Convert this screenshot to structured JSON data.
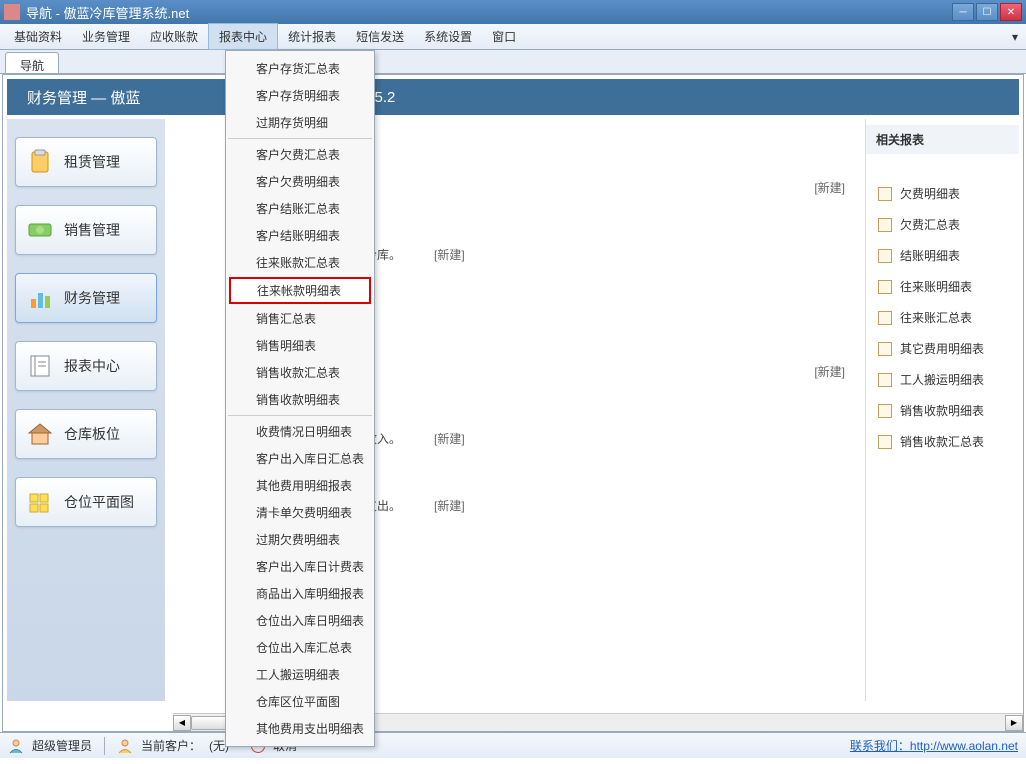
{
  "window": {
    "title": "导航 - 傲蓝冷库管理系统.net"
  },
  "menubar": {
    "items": [
      "基础资料",
      "业务管理",
      "应收账款",
      "报表中心",
      "统计报表",
      "短信发送",
      "系统设置",
      "窗口"
    ]
  },
  "tabstrip": {
    "tabs": [
      "导航"
    ]
  },
  "banner": {
    "text_left": "财务管理  ―  傲蓝",
    "text_right": "v5.2"
  },
  "sidebar": {
    "items": [
      {
        "label": "租赁管理"
      },
      {
        "label": "销售管理"
      },
      {
        "label": "财务管理"
      },
      {
        "label": "报表中心"
      },
      {
        "label": "仓库板位"
      },
      {
        "label": "仓位平面图"
      }
    ]
  },
  "main_items": [
    {
      "text": "",
      "new": "[新建]"
    },
    {
      "text": "冷库。",
      "new": "[新建]"
    },
    {
      "text": "",
      "new": "[新建]"
    },
    {
      "text": "收入。",
      "new": "[新建]"
    },
    {
      "text": "支出。",
      "new": "[新建]"
    }
  ],
  "right_panel": {
    "title": "相关报表",
    "items": [
      "欠费明细表",
      "欠费汇总表",
      "结账明细表",
      "往来账明细表",
      "往来账汇总表",
      "其它费用明细表",
      "工人搬运明细表",
      "销售收款明细表",
      "销售收款汇总表"
    ]
  },
  "dropdown": {
    "groups": [
      [
        "客户存货汇总表",
        "客户存货明细表",
        "过期存货明细"
      ],
      [
        "客户欠费汇总表",
        "客户欠费明细表",
        "客户结账汇总表",
        "客户结账明细表",
        "往来账款汇总表",
        "往来帐款明细表",
        "销售汇总表",
        "销售明细表",
        "销售收款汇总表",
        "销售收款明细表"
      ],
      [
        "收费情况日明细表",
        "客户出入库日汇总表",
        "其他费用明细报表",
        "清卡单欠费明细表",
        "过期欠费明细表",
        "客户出入库日计费表",
        "商品出入库明细报表",
        "仓位出入库日明细表",
        "仓位出入库汇总表",
        "工人搬运明细表",
        "仓库区位平面图",
        "其他费用支出明细表"
      ]
    ],
    "highlighted": "往来帐款明细表"
  },
  "statusbar": {
    "user": "超级管理员",
    "customer_label": "当前客户：",
    "customer_value": "(无)",
    "cancel": "取消",
    "contact_label": "联系我们：",
    "link": "http://www.aolan.net"
  }
}
